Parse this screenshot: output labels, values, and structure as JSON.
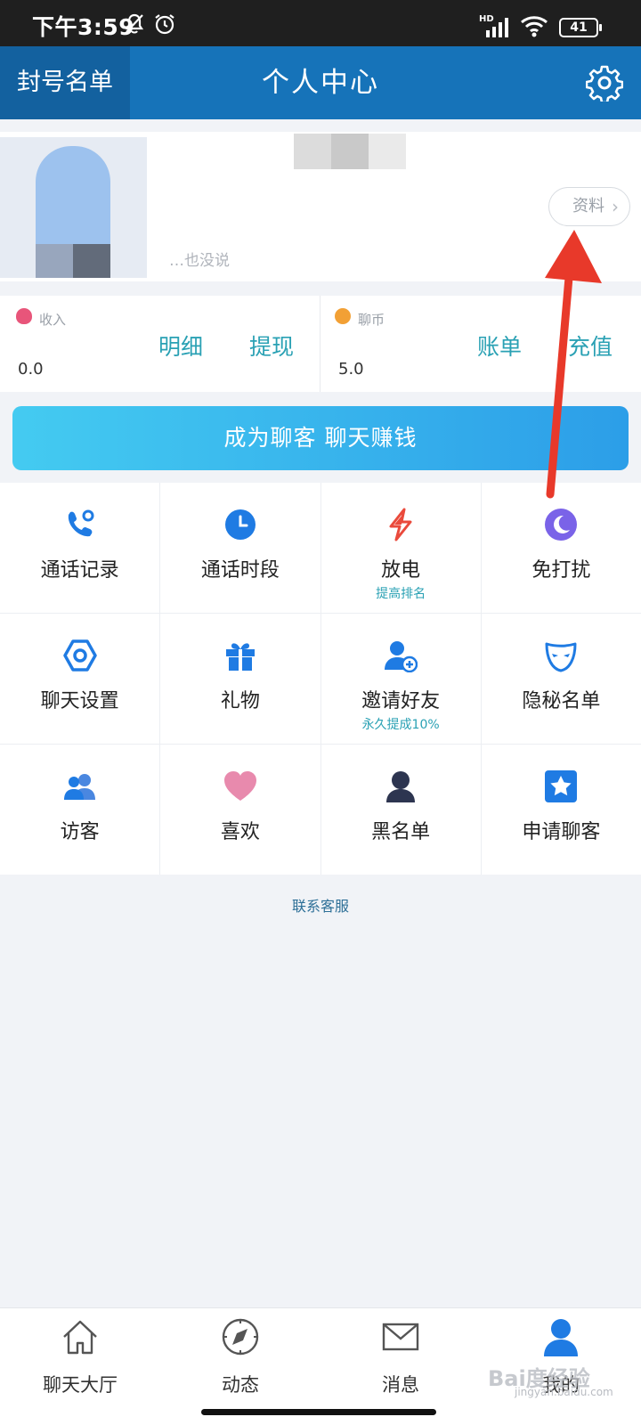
{
  "status_bar": {
    "time": "下午3:59",
    "network": "HD",
    "battery": "41"
  },
  "header": {
    "left_button": "封号名单",
    "title": "个人中心",
    "settings_icon": "gear-icon"
  },
  "profile": {
    "signature": "…也没说",
    "profile_button": "资料",
    "chevron": "›"
  },
  "wallet": {
    "income": {
      "label": "收入",
      "value": "0.0",
      "links": [
        "明细",
        "提现"
      ],
      "icon_color": "#e8557a"
    },
    "coins": {
      "label": "聊币",
      "value": "5.0",
      "links": [
        "账单",
        "充值"
      ],
      "icon_color": "#f2a035"
    }
  },
  "banner": {
    "label": "成为聊客 聊天赚钱"
  },
  "features": [
    {
      "label": "通话记录",
      "sub": "",
      "icon": "phone-icon"
    },
    {
      "label": "通话时段",
      "sub": "",
      "icon": "clock-icon"
    },
    {
      "label": "放电",
      "sub": "提高排名",
      "icon": "lightning-icon"
    },
    {
      "label": "免打扰",
      "sub": "",
      "icon": "moon-icon"
    },
    {
      "label": "聊天设置",
      "sub": "",
      "icon": "hexagon-settings-icon"
    },
    {
      "label": "礼物",
      "sub": "",
      "icon": "gift-icon"
    },
    {
      "label": "邀请好友",
      "sub": "永久提成10%",
      "icon": "add-user-icon"
    },
    {
      "label": "隐秘名单",
      "sub": "",
      "icon": "mask-icon"
    },
    {
      "label": "访客",
      "sub": "",
      "icon": "visitors-icon"
    },
    {
      "label": "喜欢",
      "sub": "",
      "icon": "heart-icon"
    },
    {
      "label": "黑名单",
      "sub": "",
      "icon": "person-dark-icon"
    },
    {
      "label": "申请聊客",
      "sub": "",
      "icon": "star-badge-icon"
    }
  ],
  "contact": {
    "label": "联系客服"
  },
  "bottom_nav": [
    {
      "label": "聊天大厅",
      "icon": "home-icon",
      "active": false
    },
    {
      "label": "动态",
      "icon": "compass-icon",
      "active": false
    },
    {
      "label": "消息",
      "icon": "mail-icon",
      "active": false
    },
    {
      "label": "我的",
      "icon": "user-icon",
      "active": true
    }
  ],
  "watermark": {
    "text": "Bai度经验",
    "sub": "jingyan.baidu.com"
  },
  "colors": {
    "header": "#1673b9",
    "accent": "#2aa1b4",
    "annotation_arrow": "#e8392a"
  }
}
